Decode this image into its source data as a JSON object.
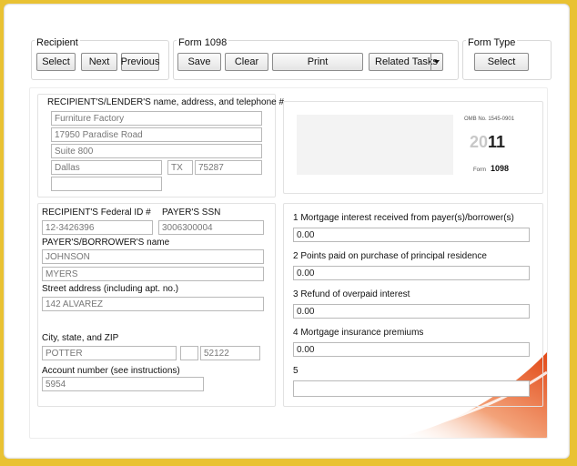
{
  "toolbar": {
    "recipient": {
      "label": "Recipient",
      "select": "Select",
      "next": "Next",
      "previous": "Previous"
    },
    "form": {
      "label": "Form 1098",
      "save": "Save",
      "clear": "Clear",
      "print": "Print",
      "related_tasks": "Related Tasks"
    },
    "form_type": {
      "label": "Form Type",
      "select": "Select"
    }
  },
  "recipient_section": {
    "heading": "RECIPIENT'S/LENDER'S name, address, and telephone #",
    "name": "Furniture Factory",
    "address1": "17950 Paradise Road",
    "address2": "Suite 800",
    "city": "Dallas",
    "state": "TX",
    "zip": "75287",
    "phone": ""
  },
  "form_header": {
    "omb": "OMB No. 1545-0901",
    "year_prefix": "20",
    "year_suffix": "11",
    "form_label": "Form",
    "form_number": "1098"
  },
  "ids": {
    "recipient_id_label": "RECIPIENT'S Federal ID #",
    "recipient_id": "12-3426396",
    "payer_ssn_label": "PAYER'S SSN",
    "payer_ssn": "3006300004"
  },
  "payer": {
    "name_label": "PAYER'S/BORROWER'S name",
    "first_name": "JOHNSON",
    "last_name": "MYERS",
    "street_label": "Street address (including apt. no.)",
    "street": "142 ALVAREZ",
    "city_label": "City, state, and ZIP",
    "city": "POTTER",
    "state": "",
    "zip": "52122",
    "account_label": "Account number (see instructions)",
    "account": "5954"
  },
  "boxes": {
    "box1_label": "1 Mortgage interest received from payer(s)/borrower(s)",
    "box1": "0.00",
    "box2_label": "2 Points paid on purchase of principal residence",
    "box2": "0.00",
    "box3_label": "3 Refund of overpaid interest",
    "box3": "0.00",
    "box4_label": "4 Mortgage insurance premiums",
    "box4": "0.00",
    "box5_label": "5",
    "box5": ""
  },
  "colors": {
    "background": "#e9c233",
    "swoosh": "#e8501c"
  }
}
